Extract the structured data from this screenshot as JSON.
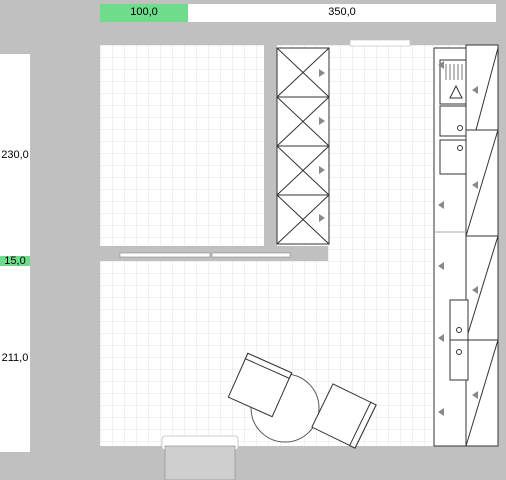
{
  "top_ruler": {
    "segments": [
      {
        "label": "100,0",
        "color": "#6fdc8c"
      },
      {
        "label": "350,0",
        "color": "#ffffff"
      }
    ]
  },
  "left_ruler": {
    "labels": [
      {
        "label": "230,0",
        "color": "#ffffff"
      },
      {
        "label": "15,0",
        "color": "#6fdc8c"
      },
      {
        "label": "211,0",
        "color": "#ffffff"
      }
    ]
  },
  "plan": {
    "floor_color": "#ffffff",
    "grid_color": "#e3e3e3",
    "wall_color": "#c0c0c0",
    "cabinet_stroke": "#333333"
  }
}
